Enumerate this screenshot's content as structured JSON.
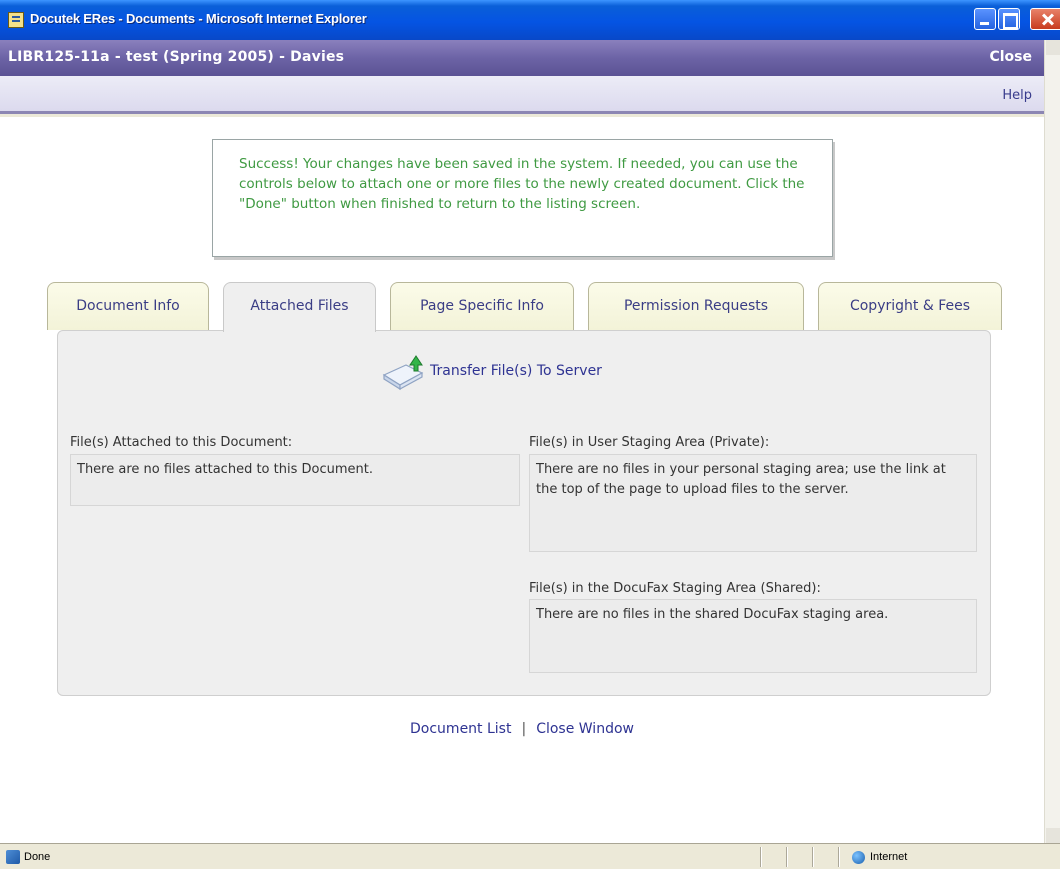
{
  "window": {
    "title": "Docutek ERes - Documents - Microsoft Internet Explorer"
  },
  "header": {
    "course": "LIBR125-11a - test (Spring 2005) - Davies",
    "close_label": "Close",
    "help_label": "Help"
  },
  "message": {
    "text": "Success! Your changes have been saved in the system. If needed, you can use the controls below to attach one or more files to the newly created document. Click the \"Done\" button when finished to return to the listing screen."
  },
  "tabs": [
    {
      "label": "Document Info",
      "active": false
    },
    {
      "label": "Attached Files",
      "active": true
    },
    {
      "label": "Page Specific Info",
      "active": false
    },
    {
      "label": "Permission Requests",
      "active": false
    },
    {
      "label": "Copyright & Fees",
      "active": false
    }
  ],
  "panel": {
    "transfer_label": "Transfer File(s) To Server",
    "attached": {
      "label": "File(s) Attached to this Document:",
      "text": "There are no files attached to this Document."
    },
    "user_staging": {
      "label": "File(s) in User Staging Area (Private):",
      "text": "There are no files in your personal staging area; use the link at the top of the page to upload files to the server."
    },
    "docufax_staging": {
      "label": "File(s) in the DocuFax Staging Area (Shared):",
      "text": "There are no files in the shared DocuFax staging area."
    }
  },
  "footer_links": {
    "document_list": "Document List",
    "separator": "|",
    "close_window": "Close Window"
  },
  "statusbar": {
    "status": "Done",
    "zone": "Internet"
  },
  "colors": {
    "header_purple": "#6c63a6",
    "success_green": "#3f9a42",
    "link_blue": "#2e3392"
  }
}
